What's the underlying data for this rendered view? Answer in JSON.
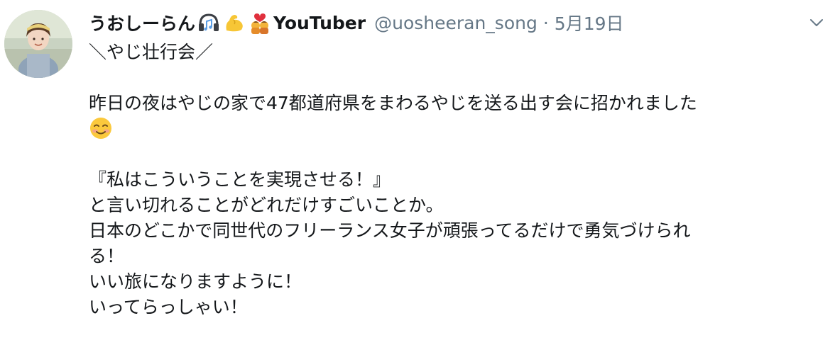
{
  "tweet": {
    "display_name": "うおしーらん",
    "name_emojis": [
      "headphones-music-icon",
      "flexed-biceps-icon",
      "kiss-couple-icon"
    ],
    "name_suffix": "YouTuber",
    "handle": "@uosheeran_song",
    "separator": "·",
    "timestamp": "5月19日",
    "lines": {
      "l1": "＼やじ壮行会／",
      "l2": "昨日の夜はやじの家で47都道府県をまわるやじを送る出す会に招かれました",
      "l3_emoji": "smiling-face-icon",
      "l4": "『私はこういうことを実現させる！』",
      "l5": "と言い切れることがどれだけすごいことか。",
      "l6": "日本のどこかで同世代のフリーランス女子が頑張ってるだけで勇気づけられ",
      "l7": "る！",
      "l8": "いい旅になりますように！",
      "l9": "いってらっしゃい！"
    }
  },
  "colors": {
    "text": "#14171a",
    "secondary": "#657786",
    "background": "#ffffff"
  }
}
